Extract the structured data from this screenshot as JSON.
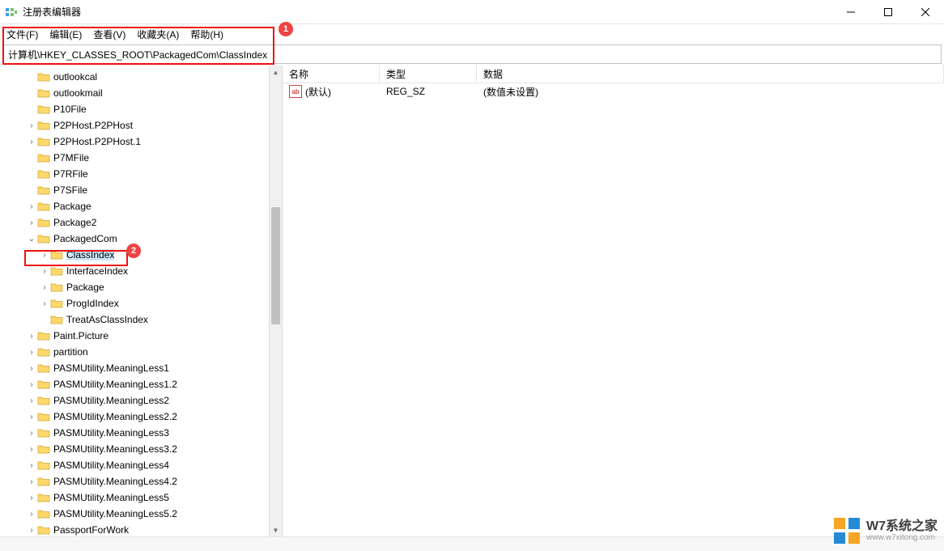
{
  "window": {
    "title": "注册表编辑器"
  },
  "menu": {
    "file": "文件(F)",
    "edit": "编辑(E)",
    "view": "查看(V)",
    "favorites": "收藏夹(A)",
    "help": "帮助(H)"
  },
  "path": "计算机\\HKEY_CLASSES_ROOT\\PackagedCom\\ClassIndex",
  "callouts": {
    "one": "1",
    "two": "2"
  },
  "tree": {
    "items": [
      {
        "indent": 2,
        "expander": "",
        "label": "outlookcal"
      },
      {
        "indent": 2,
        "expander": "",
        "label": "outlookmail"
      },
      {
        "indent": 2,
        "expander": "",
        "label": "P10File"
      },
      {
        "indent": 2,
        "expander": ">",
        "label": "P2PHost.P2PHost"
      },
      {
        "indent": 2,
        "expander": ">",
        "label": "P2PHost.P2PHost.1"
      },
      {
        "indent": 2,
        "expander": "",
        "label": "P7MFile"
      },
      {
        "indent": 2,
        "expander": "",
        "label": "P7RFile"
      },
      {
        "indent": 2,
        "expander": "",
        "label": "P7SFile"
      },
      {
        "indent": 2,
        "expander": ">",
        "label": "Package"
      },
      {
        "indent": 2,
        "expander": ">",
        "label": "Package2"
      },
      {
        "indent": 2,
        "expander": "v",
        "label": "PackagedCom"
      },
      {
        "indent": 3,
        "expander": ">",
        "label": "ClassIndex",
        "selected": true
      },
      {
        "indent": 3,
        "expander": ">",
        "label": "InterfaceIndex"
      },
      {
        "indent": 3,
        "expander": ">",
        "label": "Package"
      },
      {
        "indent": 3,
        "expander": ">",
        "label": "ProgIdIndex"
      },
      {
        "indent": 3,
        "expander": "",
        "label": "TreatAsClassIndex"
      },
      {
        "indent": 2,
        "expander": ">",
        "label": "Paint.Picture"
      },
      {
        "indent": 2,
        "expander": ">",
        "label": "partition"
      },
      {
        "indent": 2,
        "expander": ">",
        "label": "PASMUtility.MeaningLess1"
      },
      {
        "indent": 2,
        "expander": ">",
        "label": "PASMUtility.MeaningLess1.2"
      },
      {
        "indent": 2,
        "expander": ">",
        "label": "PASMUtility.MeaningLess2"
      },
      {
        "indent": 2,
        "expander": ">",
        "label": "PASMUtility.MeaningLess2.2"
      },
      {
        "indent": 2,
        "expander": ">",
        "label": "PASMUtility.MeaningLess3"
      },
      {
        "indent": 2,
        "expander": ">",
        "label": "PASMUtility.MeaningLess3.2"
      },
      {
        "indent": 2,
        "expander": ">",
        "label": "PASMUtility.MeaningLess4"
      },
      {
        "indent": 2,
        "expander": ">",
        "label": "PASMUtility.MeaningLess4.2"
      },
      {
        "indent": 2,
        "expander": ">",
        "label": "PASMUtility.MeaningLess5"
      },
      {
        "indent": 2,
        "expander": ">",
        "label": "PASMUtility.MeaningLess5.2"
      },
      {
        "indent": 2,
        "expander": ">",
        "label": "PassportForWork"
      }
    ]
  },
  "list": {
    "headers": {
      "name": "名称",
      "type": "类型",
      "data": "数据"
    },
    "rows": [
      {
        "name": "(默认)",
        "type": "REG_SZ",
        "data": "(数值未设置)"
      }
    ]
  },
  "watermark": {
    "main": "W7系统之家",
    "sub": "www.w7xitong.com"
  }
}
